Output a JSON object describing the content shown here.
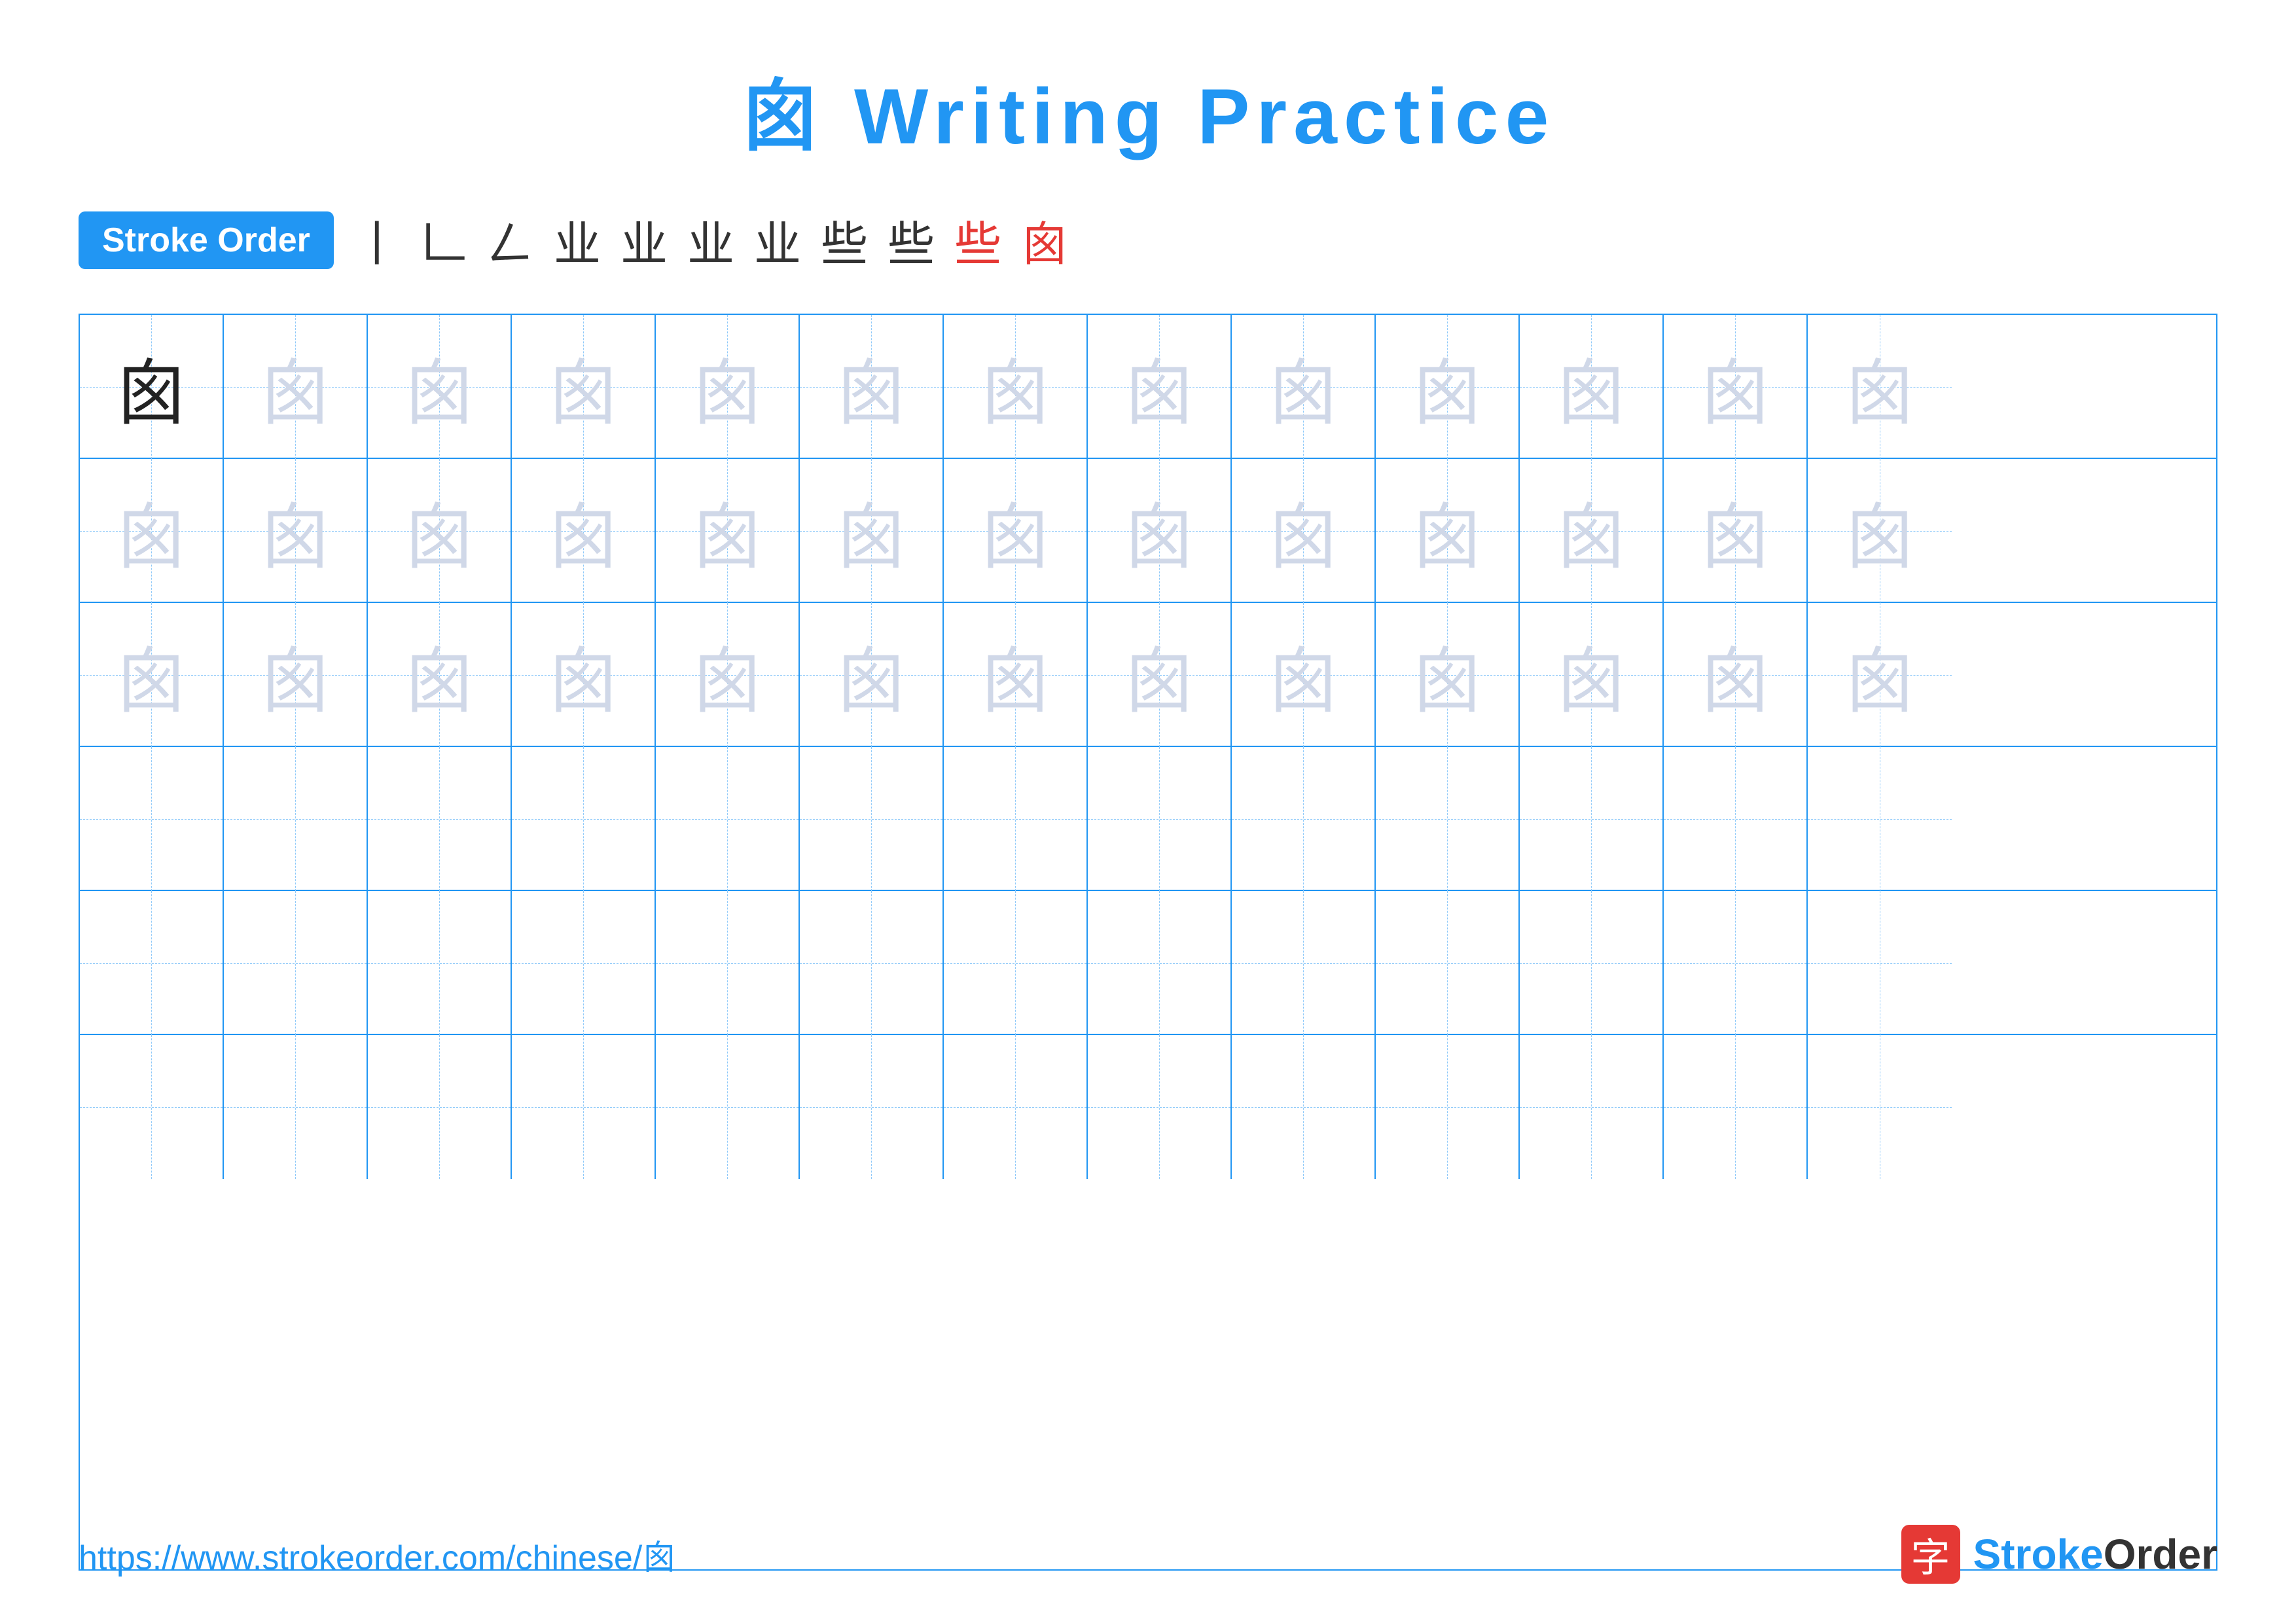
{
  "title": "囪 Writing Practice",
  "stroke_order_badge": "Stroke Order",
  "stroke_steps": [
    {
      "char": "丨",
      "red": false
    },
    {
      "char": "𠃊",
      "red": false
    },
    {
      "char": "𠃋",
      "red": false
    },
    {
      "char": "业",
      "red": false
    },
    {
      "char": "业",
      "red": false
    },
    {
      "char": "业",
      "red": false
    },
    {
      "char": "业",
      "red": false
    },
    {
      "char": "些",
      "red": false
    },
    {
      "char": "些",
      "red": false
    },
    {
      "char": "些",
      "red": true
    },
    {
      "char": "囪",
      "red": true
    }
  ],
  "character": "囪",
  "rows": [
    {
      "type": "dark_then_light",
      "dark_count": 1,
      "total": 13
    },
    {
      "type": "all_light",
      "total": 13
    },
    {
      "type": "all_light",
      "total": 13
    },
    {
      "type": "empty",
      "total": 13
    },
    {
      "type": "empty",
      "total": 13
    },
    {
      "type": "empty",
      "total": 13
    }
  ],
  "footer": {
    "url": "https://www.strokeorder.com/chinese/囪",
    "logo_char": "字",
    "logo_text_stroke": "Stroke",
    "logo_text_order": "Order"
  }
}
